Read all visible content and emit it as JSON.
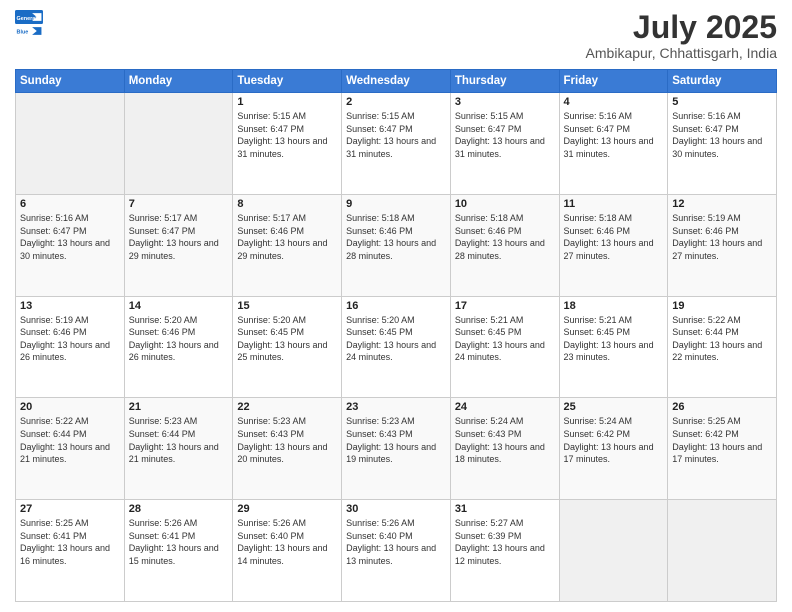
{
  "logo": {
    "general": "General",
    "blue": "Blue"
  },
  "title": "July 2025",
  "location": "Ambikapur, Chhattisgarh, India",
  "days_of_week": [
    "Sunday",
    "Monday",
    "Tuesday",
    "Wednesday",
    "Thursday",
    "Friday",
    "Saturday"
  ],
  "weeks": [
    [
      {
        "day": "",
        "info": ""
      },
      {
        "day": "",
        "info": ""
      },
      {
        "day": "1",
        "info": "Sunrise: 5:15 AM\nSunset: 6:47 PM\nDaylight: 13 hours and 31 minutes."
      },
      {
        "day": "2",
        "info": "Sunrise: 5:15 AM\nSunset: 6:47 PM\nDaylight: 13 hours and 31 minutes."
      },
      {
        "day": "3",
        "info": "Sunrise: 5:15 AM\nSunset: 6:47 PM\nDaylight: 13 hours and 31 minutes."
      },
      {
        "day": "4",
        "info": "Sunrise: 5:16 AM\nSunset: 6:47 PM\nDaylight: 13 hours and 31 minutes."
      },
      {
        "day": "5",
        "info": "Sunrise: 5:16 AM\nSunset: 6:47 PM\nDaylight: 13 hours and 30 minutes."
      }
    ],
    [
      {
        "day": "6",
        "info": "Sunrise: 5:16 AM\nSunset: 6:47 PM\nDaylight: 13 hours and 30 minutes."
      },
      {
        "day": "7",
        "info": "Sunrise: 5:17 AM\nSunset: 6:47 PM\nDaylight: 13 hours and 29 minutes."
      },
      {
        "day": "8",
        "info": "Sunrise: 5:17 AM\nSunset: 6:46 PM\nDaylight: 13 hours and 29 minutes."
      },
      {
        "day": "9",
        "info": "Sunrise: 5:18 AM\nSunset: 6:46 PM\nDaylight: 13 hours and 28 minutes."
      },
      {
        "day": "10",
        "info": "Sunrise: 5:18 AM\nSunset: 6:46 PM\nDaylight: 13 hours and 28 minutes."
      },
      {
        "day": "11",
        "info": "Sunrise: 5:18 AM\nSunset: 6:46 PM\nDaylight: 13 hours and 27 minutes."
      },
      {
        "day": "12",
        "info": "Sunrise: 5:19 AM\nSunset: 6:46 PM\nDaylight: 13 hours and 27 minutes."
      }
    ],
    [
      {
        "day": "13",
        "info": "Sunrise: 5:19 AM\nSunset: 6:46 PM\nDaylight: 13 hours and 26 minutes."
      },
      {
        "day": "14",
        "info": "Sunrise: 5:20 AM\nSunset: 6:46 PM\nDaylight: 13 hours and 26 minutes."
      },
      {
        "day": "15",
        "info": "Sunrise: 5:20 AM\nSunset: 6:45 PM\nDaylight: 13 hours and 25 minutes."
      },
      {
        "day": "16",
        "info": "Sunrise: 5:20 AM\nSunset: 6:45 PM\nDaylight: 13 hours and 24 minutes."
      },
      {
        "day": "17",
        "info": "Sunrise: 5:21 AM\nSunset: 6:45 PM\nDaylight: 13 hours and 24 minutes."
      },
      {
        "day": "18",
        "info": "Sunrise: 5:21 AM\nSunset: 6:45 PM\nDaylight: 13 hours and 23 minutes."
      },
      {
        "day": "19",
        "info": "Sunrise: 5:22 AM\nSunset: 6:44 PM\nDaylight: 13 hours and 22 minutes."
      }
    ],
    [
      {
        "day": "20",
        "info": "Sunrise: 5:22 AM\nSunset: 6:44 PM\nDaylight: 13 hours and 21 minutes."
      },
      {
        "day": "21",
        "info": "Sunrise: 5:23 AM\nSunset: 6:44 PM\nDaylight: 13 hours and 21 minutes."
      },
      {
        "day": "22",
        "info": "Sunrise: 5:23 AM\nSunset: 6:43 PM\nDaylight: 13 hours and 20 minutes."
      },
      {
        "day": "23",
        "info": "Sunrise: 5:23 AM\nSunset: 6:43 PM\nDaylight: 13 hours and 19 minutes."
      },
      {
        "day": "24",
        "info": "Sunrise: 5:24 AM\nSunset: 6:43 PM\nDaylight: 13 hours and 18 minutes."
      },
      {
        "day": "25",
        "info": "Sunrise: 5:24 AM\nSunset: 6:42 PM\nDaylight: 13 hours and 17 minutes."
      },
      {
        "day": "26",
        "info": "Sunrise: 5:25 AM\nSunset: 6:42 PM\nDaylight: 13 hours and 17 minutes."
      }
    ],
    [
      {
        "day": "27",
        "info": "Sunrise: 5:25 AM\nSunset: 6:41 PM\nDaylight: 13 hours and 16 minutes."
      },
      {
        "day": "28",
        "info": "Sunrise: 5:26 AM\nSunset: 6:41 PM\nDaylight: 13 hours and 15 minutes."
      },
      {
        "day": "29",
        "info": "Sunrise: 5:26 AM\nSunset: 6:40 PM\nDaylight: 13 hours and 14 minutes."
      },
      {
        "day": "30",
        "info": "Sunrise: 5:26 AM\nSunset: 6:40 PM\nDaylight: 13 hours and 13 minutes."
      },
      {
        "day": "31",
        "info": "Sunrise: 5:27 AM\nSunset: 6:39 PM\nDaylight: 13 hours and 12 minutes."
      },
      {
        "day": "",
        "info": ""
      },
      {
        "day": "",
        "info": ""
      }
    ]
  ]
}
